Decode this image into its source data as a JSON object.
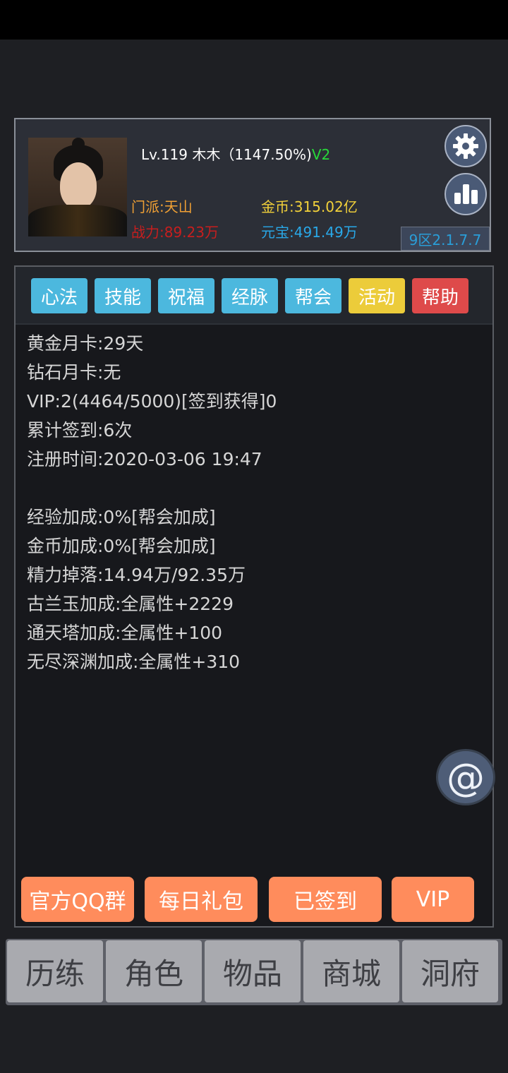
{
  "header": {
    "level_name": "Lv.119 木木（1147.50%)",
    "vip_tag": "V2",
    "sect": "门派:天山",
    "power": "战力:89.23万",
    "gold": "金币:315.02亿",
    "yuanbao": "元宝:491.49万",
    "server_version": "9区2.1.7.7",
    "colors": {
      "sect": "#f0a034",
      "power": "#c81e1e",
      "gold": "#f2d13a",
      "yuanbao": "#29a8e8",
      "vip": "#28d83a"
    }
  },
  "tabs": [
    {
      "label": "心法",
      "color": "#4cb8de"
    },
    {
      "label": "技能",
      "color": "#4cb8de"
    },
    {
      "label": "祝福",
      "color": "#4cb8de"
    },
    {
      "label": "经脉",
      "color": "#4cb8de"
    },
    {
      "label": "帮会",
      "color": "#4cb8de"
    },
    {
      "label": "活动",
      "color": "#eccc3a"
    },
    {
      "label": "帮助",
      "color": "#de4a4a"
    }
  ],
  "info": {
    "group1": [
      "黄金月卡:29天",
      "钻石月卡:无",
      "VIP:2(4464/5000)[签到获得]0",
      "累计签到:6次",
      "注册时间:2020-03-06 19:47"
    ],
    "group2": [
      "经验加成:0%[帮会加成]",
      "金币加成:0%[帮会加成]",
      "精力掉落:14.94万/92.35万",
      "古兰玉加成:全属性+2229",
      "通天塔加成:全属性+100",
      "无尽深渊加成:全属性+310"
    ]
  },
  "floating": {
    "at_symbol": "@"
  },
  "actions": [
    "官方QQ群",
    "每日礼包",
    "已签到",
    "VIP"
  ],
  "action_color": "#ff8c5c",
  "nav": [
    "历练",
    "角色",
    "物品",
    "商城",
    "洞府"
  ]
}
